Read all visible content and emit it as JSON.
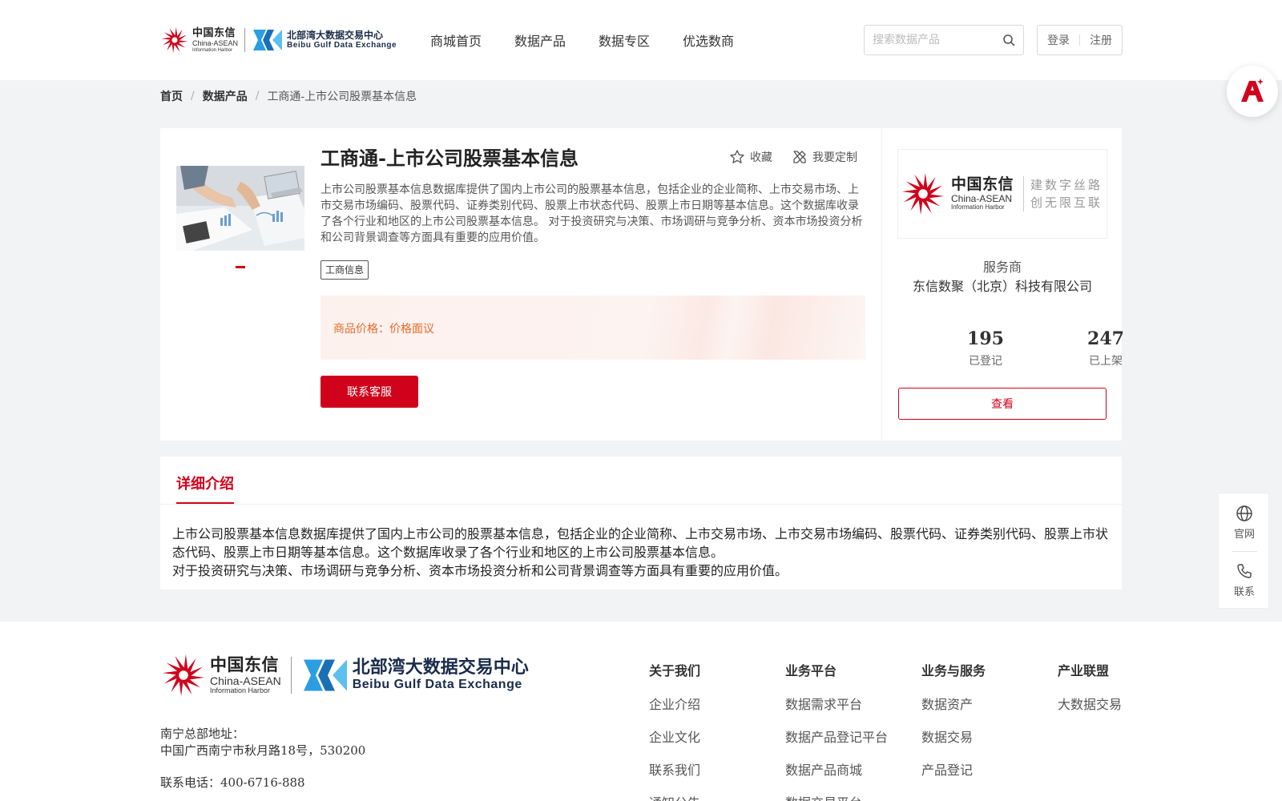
{
  "header": {
    "logo_cd": {
      "cn": "中国东信",
      "en1": "China-ASEAN",
      "en2": "Information Harbor"
    },
    "logo_bb": {
      "cn": "北部湾大数据交易中心",
      "en": "Beibu Gulf Data Exchange"
    },
    "nav": [
      {
        "label": "商城首页"
      },
      {
        "label": "数据产品"
      },
      {
        "label": "数据专区"
      },
      {
        "label": "优选数商"
      }
    ],
    "search": {
      "placeholder": "搜索数据产品",
      "value": ""
    },
    "login_label": "登录",
    "register_label": "注册"
  },
  "breadcrumb": {
    "home": "首页",
    "category": "数据产品",
    "current": "工商通-上市公司股票基本信息",
    "separator": "/"
  },
  "product": {
    "title": "工商通-上市公司股票基本信息",
    "favorite_label": "收藏",
    "customize_label": "我要定制",
    "description": "上市公司股票基本信息数据库提供了国内上市公司的股票基本信息，包括企业的企业简称、上市交易市场、上市交易市场编码、股票代码、证券类别代码、股票上市状态代码、股票上市日期等基本信息。这个数据库收录了各个行业和地区的上市公司股票基本信息。 对于投资研究与决策、市场调研与竞争分析、资本市场投资分析和公司背景调查等方面具有重要的应用价值。",
    "tag": "工商信息",
    "price_label": "商品价格：",
    "price_value": "价格面议",
    "contact_button": "联系客服"
  },
  "provider": {
    "logo_cn": "中国东信",
    "logo_en1": "China-ASEAN",
    "logo_en2": "Information Harbor",
    "slogan_line1": "建数字丝路",
    "slogan_line2": "创无限互联",
    "label": "服务商",
    "name": "东信数聚（北京）科技有限公司",
    "stats": [
      {
        "value": "195",
        "label": "已登记"
      },
      {
        "value": "247",
        "label": "已上架"
      }
    ],
    "view_button": "查看"
  },
  "detail": {
    "tab_label": "详细介绍",
    "para1": "上市公司股票基本信息数据库提供了国内上市公司的股票基本信息，包括企业的企业简称、上市交易市场、上市交易市场编码、股票代码、证券类别代码、股票上市状态代码、股票上市日期等基本信息。这个数据库收录了各个行业和地区的上市公司股票基本信息。",
    "para2": "对于投资研究与决策、市场调研与竞争分析、资本市场投资分析和公司背景调查等方面具有重要的应用价值。"
  },
  "side": {
    "website_label": "官网",
    "contact_label": "联系"
  },
  "footer": {
    "address_label": "南宁总部地址：",
    "address": "中国广西南宁市秋月路18号，530200",
    "phone": "联系电话：400-6716-888",
    "columns": [
      {
        "title": "关于我们",
        "links": [
          "企业介绍",
          "企业文化",
          "联系我们",
          "通知公告"
        ]
      },
      {
        "title": "业务平台",
        "links": [
          "数据需求平台",
          "数据产品登记平台",
          "数据产品商城",
          "数据交易平台"
        ]
      },
      {
        "title": "业务与服务",
        "links": [
          "数据资产",
          "数据交易",
          "产品登记"
        ]
      },
      {
        "title": "产业联盟",
        "links": [
          "大数据交易"
        ]
      }
    ]
  },
  "colors": {
    "brand_red": "#d0021b",
    "price_orange": "#e86a2b",
    "bb_blue": "#2a9ee0",
    "bb_navy": "#1a2b4a"
  },
  "icons": [
    "cd-sunburst-logo-icon",
    "bb-3x-logo-icon",
    "search-icon",
    "star-icon",
    "customize-icon",
    "ai-assistant-icon",
    "globe-icon",
    "phone-icon"
  ]
}
